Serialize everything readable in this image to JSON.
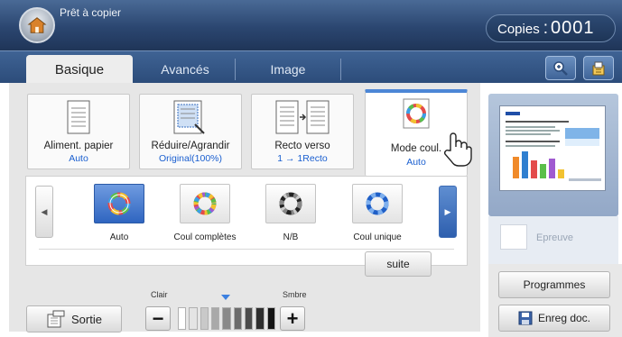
{
  "status": {
    "message": "Prêt à copier",
    "copies_label": "Copies",
    "copies_colon": ":",
    "copies_value": "0001"
  },
  "tabs": [
    {
      "label": "Basique",
      "active": true
    },
    {
      "label": "Avancés",
      "active": false
    },
    {
      "label": "Image",
      "active": false
    }
  ],
  "toolbar_icons": [
    "zoom-icon",
    "job-status-icon"
  ],
  "functions": [
    {
      "label": "Aliment. papier",
      "value": "Auto",
      "icon": "paper-tray-icon"
    },
    {
      "label": "Réduire/Agrandir",
      "value": "Original(100%)",
      "icon": "reduce-enlarge-icon"
    },
    {
      "label": "Recto verso",
      "value": "1 → 1Recto",
      "icon": "duplex-icon"
    },
    {
      "label": "Mode coul.",
      "value": "Auto",
      "icon": "color-mode-icon",
      "active": true
    }
  ],
  "color_options": [
    {
      "label": "Auto",
      "icon": "color-auto-icon",
      "selected": true
    },
    {
      "label": "Coul complètes",
      "icon": "full-color-icon",
      "selected": false
    },
    {
      "label": "N/B",
      "icon": "black-white-icon",
      "selected": false
    },
    {
      "label": "Coul unique",
      "icon": "single-color-icon",
      "selected": false
    }
  ],
  "suite_label": "suite",
  "output": {
    "label": "Sortie"
  },
  "density": {
    "light_label": "Clair",
    "dark_label": "Smbre",
    "minus": "−",
    "plus": "+",
    "level": 0.5,
    "bar_colors": [
      "#ffffff",
      "#e4e4e4",
      "#c9c9c9",
      "#a9a9a9",
      "#8a8a8a",
      "#6c6c6c",
      "#4c4c4c",
      "#2e2e2e",
      "#141414"
    ]
  },
  "preview": {
    "label": "Epreuve"
  },
  "programmes_label": "Programmes",
  "save_doc_label": "Enreg doc.",
  "colors": {
    "accent": "#4c86d6",
    "value_text": "#1a5fd0",
    "topbar": "#2b4670"
  }
}
